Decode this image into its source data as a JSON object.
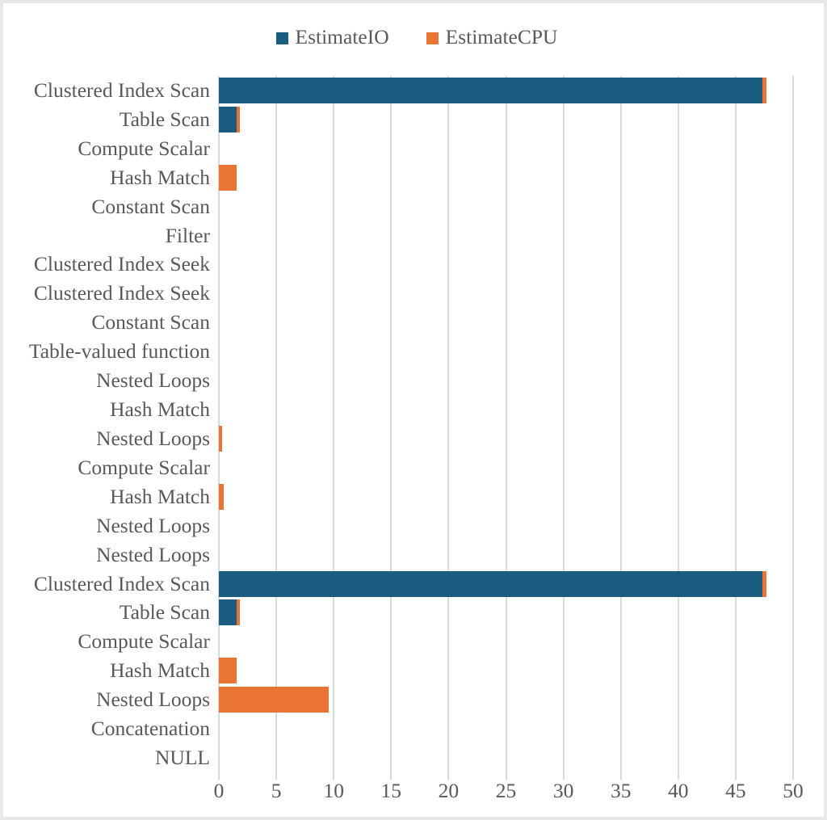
{
  "chart_data": {
    "type": "bar",
    "orientation": "horizontal",
    "stacked": true,
    "title": "",
    "subtitle": "",
    "xlabel": "",
    "ylabel": "",
    "xlim": [
      0,
      50
    ],
    "xticks": [
      0,
      5,
      10,
      15,
      20,
      25,
      30,
      35,
      40,
      45,
      50
    ],
    "xtick_labels": [
      "0",
      "5",
      "10",
      "15",
      "20",
      "25",
      "30",
      "35",
      "40",
      "45",
      "50"
    ],
    "grid": "vertical",
    "legend_position": "top-center",
    "categories": [
      "Clustered Index Scan",
      "Table Scan",
      "Compute Scalar",
      "Hash Match",
      "Constant Scan",
      "Filter",
      "Clustered Index Seek",
      "Clustered Index Seek",
      "Constant Scan",
      "Table-valued function",
      "Nested Loops",
      "Hash Match",
      "Nested Loops",
      "Compute Scalar",
      "Hash Match",
      "Nested Loops",
      "Nested Loops",
      "Clustered Index Scan",
      "Table Scan",
      "Compute Scalar",
      "Hash Match",
      "Nested Loops",
      "Concatenation",
      "NULL"
    ],
    "series": [
      {
        "name": "EstimateIO",
        "color": "#1B5D80",
        "values": [
          47.3,
          1.55,
          0,
          0,
          0,
          0,
          0,
          0,
          0,
          0,
          0,
          0,
          0,
          0,
          0,
          0,
          0,
          47.3,
          1.55,
          0,
          0,
          0,
          0,
          0
        ]
      },
      {
        "name": "EstimateCPU",
        "color": "#E97433",
        "values": [
          0.35,
          0.28,
          0,
          1.55,
          0,
          0,
          0,
          0,
          0,
          0,
          0,
          0,
          0.25,
          0,
          0.42,
          0,
          0,
          0.35,
          0.28,
          0,
          1.55,
          9.56,
          0,
          0
        ]
      }
    ]
  },
  "legend": {
    "items": [
      {
        "label": "EstimateIO",
        "color": "#1B5D80",
        "icon": "square-swatch-icon"
      },
      {
        "label": "EstimateCPU",
        "color": "#E97433",
        "icon": "square-swatch-icon"
      }
    ]
  },
  "colors": {
    "series_io": "#1B5D80",
    "series_cpu": "#E97433",
    "gridline": "#d9d9d9",
    "text": "#595959",
    "frame": "#e8e8e8",
    "background": "#ffffff"
  }
}
